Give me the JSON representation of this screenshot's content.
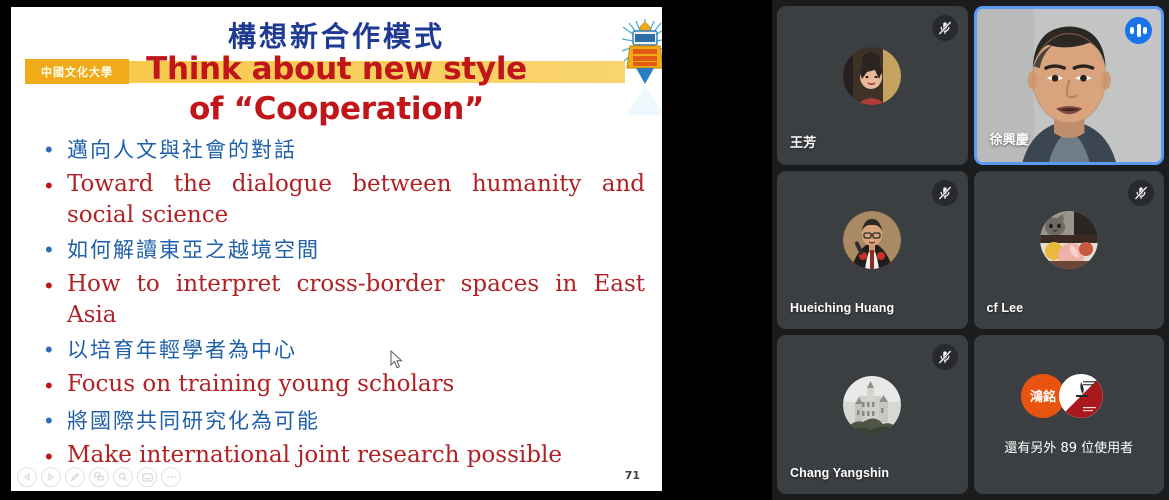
{
  "slide": {
    "university_logo_text": "中國文化大學",
    "title_cn": "構想新合作模式",
    "title_en_line1": "Think about new style",
    "title_en_line2": "of “Cooperation”",
    "slide_number": "71",
    "colors": {
      "title_cn": "#1f3a93",
      "title_en": "#c0161a",
      "gold_bar": "#f5c242",
      "bullet_cn": "#2060a8",
      "bullet_en": "#b02225"
    },
    "bullets": [
      {
        "lang": "cn",
        "text": "邁向人文與社會的對話"
      },
      {
        "lang": "en",
        "text": "Toward the dialogue between humanity and social science"
      },
      {
        "lang": "cn",
        "text": "如何解讀東亞之越境空間"
      },
      {
        "lang": "en",
        "text": "How to interpret cross-border spaces in East Asia"
      },
      {
        "lang": "cn",
        "text": "以培育年輕學者為中心"
      },
      {
        "lang": "en",
        "text": "Focus on training young scholars"
      },
      {
        "lang": "cn",
        "text": "將國際共同研究化為可能"
      },
      {
        "lang": "en",
        "text": "Make international joint research possible"
      }
    ],
    "presenter_toolbar": [
      {
        "icon": "previous-slide-icon",
        "label": "Previous"
      },
      {
        "icon": "next-slide-icon",
        "label": "Next"
      },
      {
        "icon": "pen-icon",
        "label": "Pen"
      },
      {
        "icon": "all-slides-icon",
        "label": "See all slides"
      },
      {
        "icon": "zoom-icon",
        "label": "Zoom into slide"
      },
      {
        "icon": "captions-icon",
        "label": "Toggle subtitles"
      },
      {
        "icon": "more-options-icon",
        "label": "More slide show options"
      }
    ]
  },
  "participants": {
    "tiles": [
      {
        "name": "王芳",
        "cjk": true,
        "muted": true,
        "speaking": false,
        "video": false,
        "avatar": "photo-woman-avatar"
      },
      {
        "name": "徐興慶",
        "cjk": true,
        "muted": false,
        "speaking": true,
        "video": true,
        "avatar": "live-video-man"
      },
      {
        "name": "Hueiching Huang",
        "cjk": false,
        "muted": true,
        "speaking": false,
        "video": false,
        "avatar": "photo-man-podium-avatar"
      },
      {
        "name": "cf Lee",
        "cjk": false,
        "muted": true,
        "speaking": false,
        "video": false,
        "avatar": "photo-cat-fruit-avatar"
      },
      {
        "name": "Chang Yangshin",
        "cjk": false,
        "muted": true,
        "speaking": false,
        "video": false,
        "avatar": "photo-castle-avatar"
      }
    ],
    "overflow": {
      "label": "還有另外 89 位使用者",
      "count": "89",
      "avatar_a_text": "鴻銘",
      "avatar_a_color": "#e8540f",
      "avatar_b_color": "#a8181c"
    }
  }
}
